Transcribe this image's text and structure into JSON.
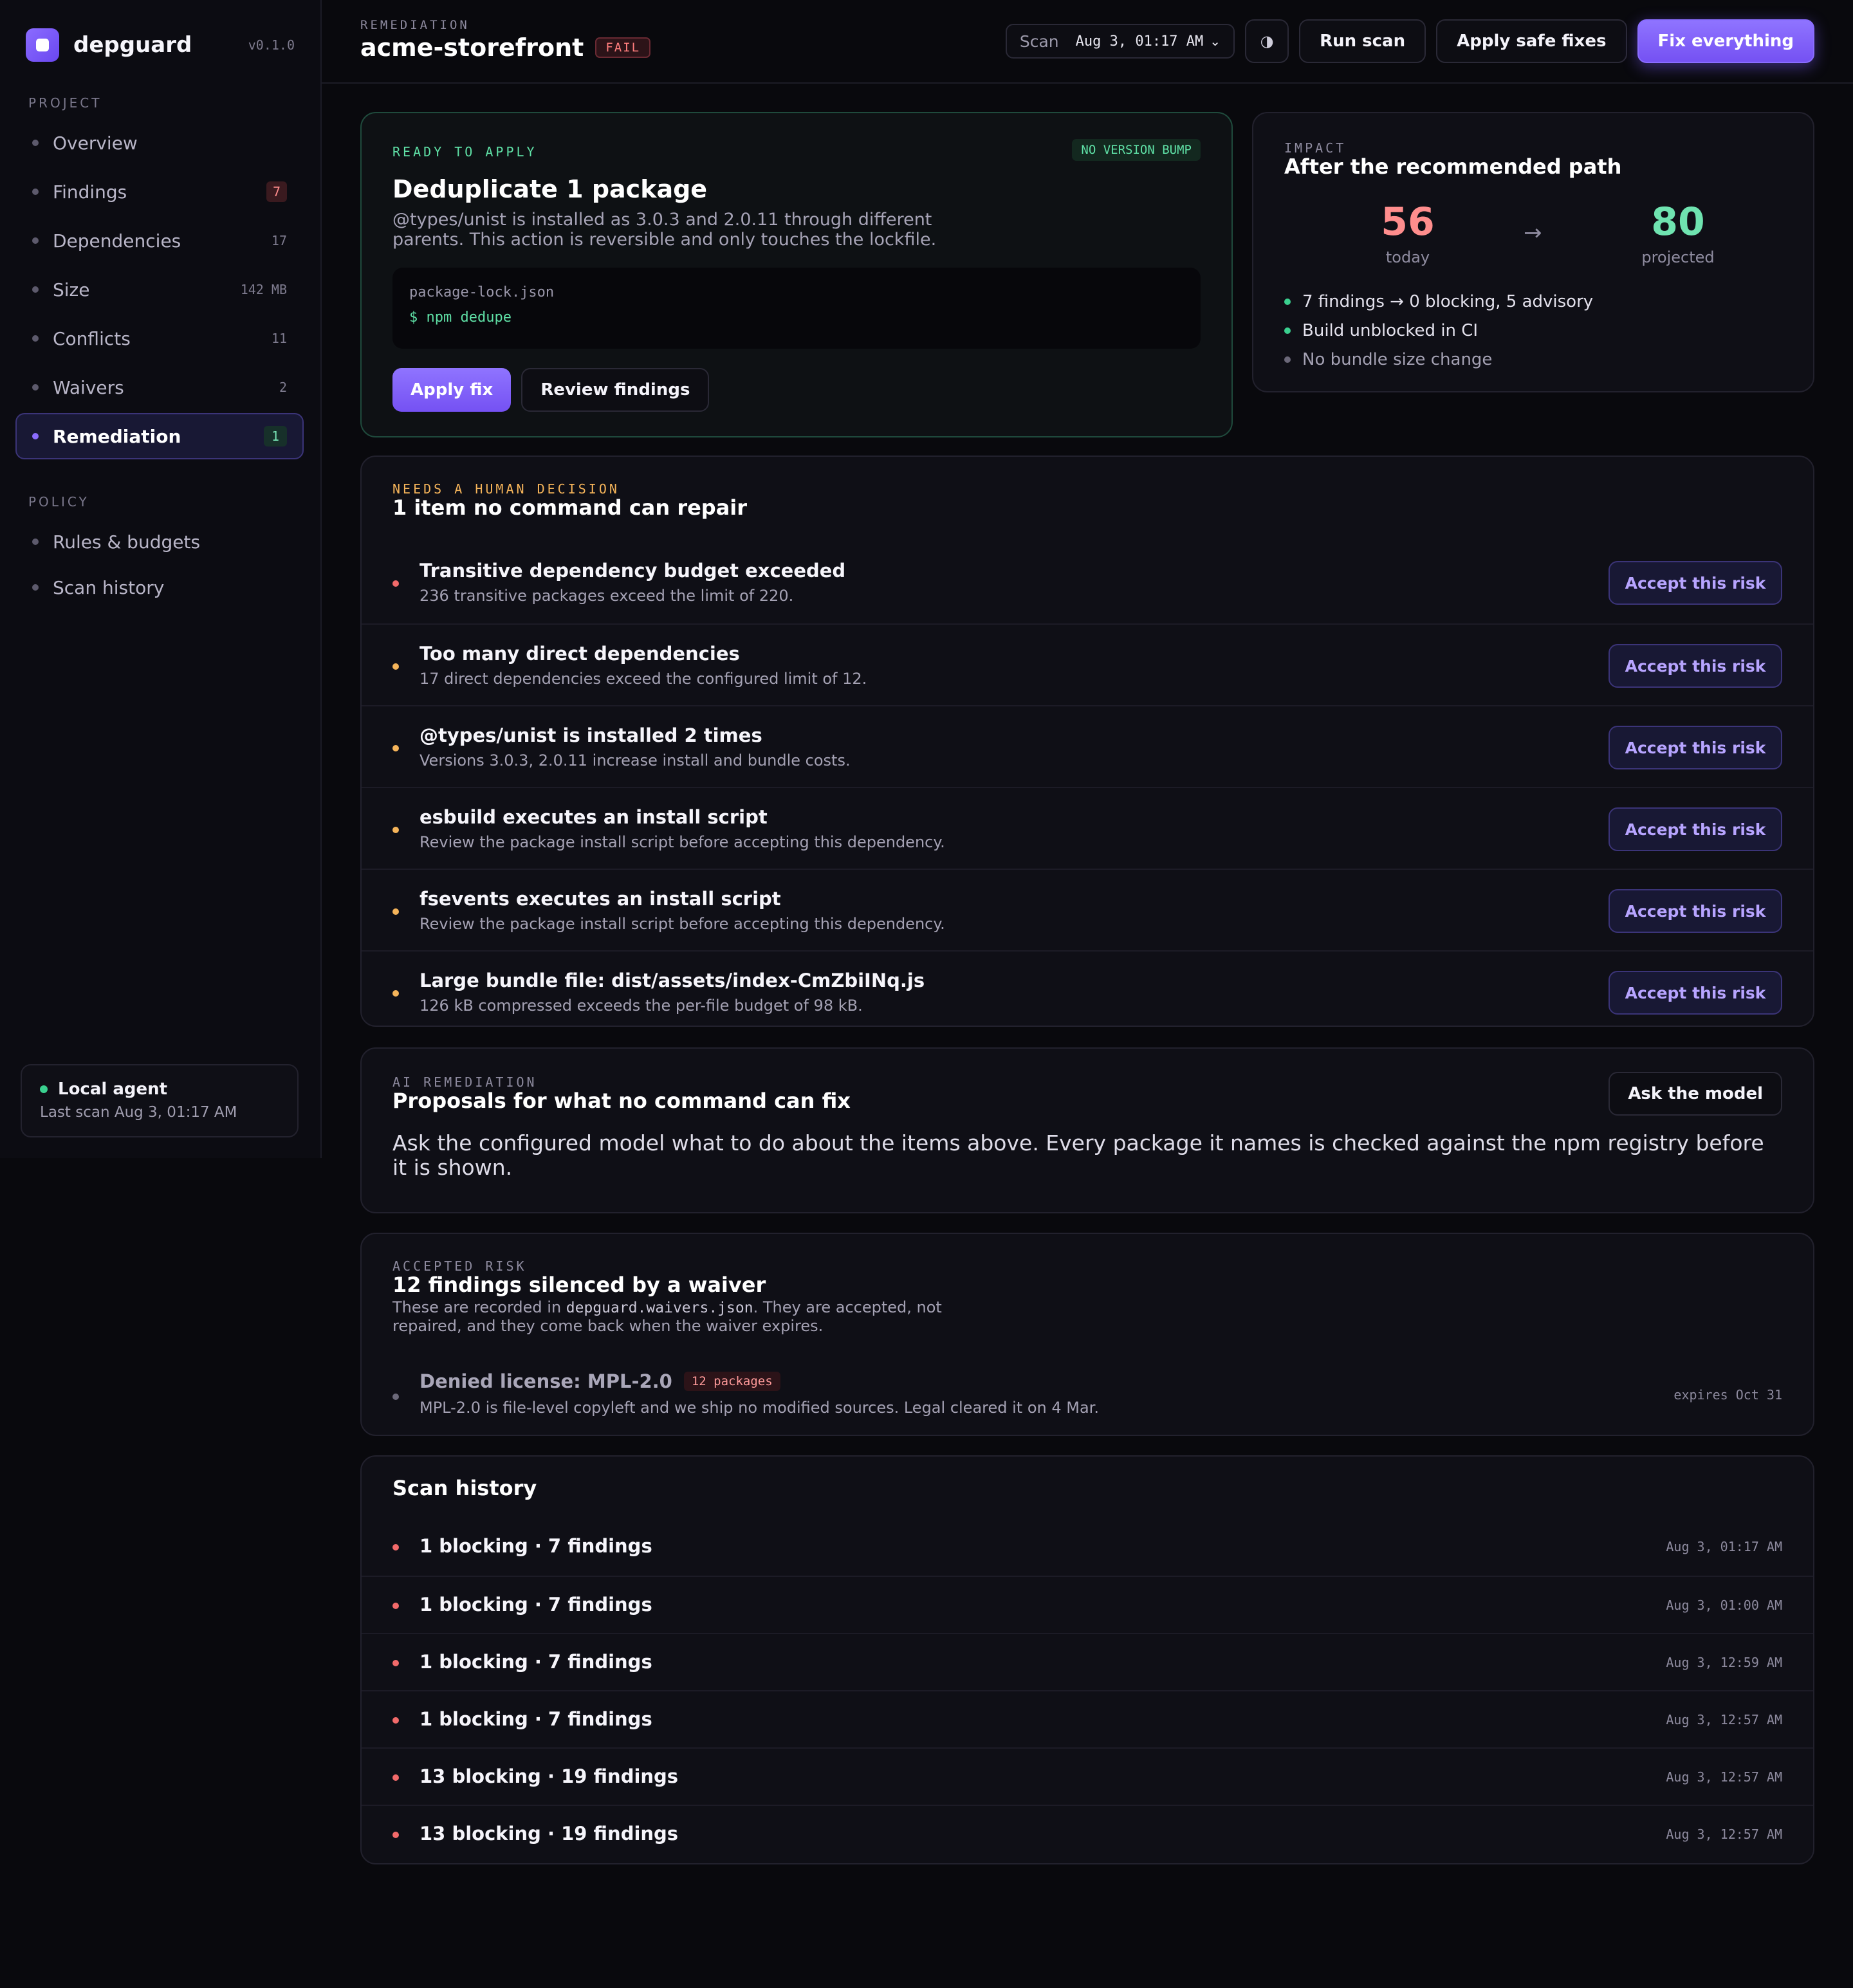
{
  "sidebar": {
    "brand": "depguard",
    "version": "v0.1.0",
    "project_label": "PROJECT",
    "nav": [
      {
        "label": "Overview",
        "count": ""
      },
      {
        "label": "Findings",
        "count": "7"
      },
      {
        "label": "Dependencies",
        "count": "17"
      },
      {
        "label": "Size",
        "count": "142 MB"
      },
      {
        "label": "Conflicts",
        "count": "11"
      },
      {
        "label": "Waivers",
        "count": "2"
      },
      {
        "label": "Remediation",
        "count": "1"
      }
    ],
    "policy_label": "POLICY",
    "policy_nav": [
      {
        "label": "Rules & budgets"
      },
      {
        "label": "Scan history"
      }
    ],
    "agent": {
      "title": "Local agent",
      "subtitle": "Last scan Aug 3, 01:17 AM"
    }
  },
  "header": {
    "kicker": "REMEDIATION",
    "title": "acme-storefront",
    "status": "FAIL",
    "scan_label": "Scan",
    "scan_value": "Aug 3, 01:17 AM",
    "theme_icon": "◑",
    "run_scan": "Run scan",
    "apply_safe": "Apply safe fixes",
    "fix_everything": "Fix everything"
  },
  "ready": {
    "kicker": "READY TO APPLY",
    "badge": "NO VERSION BUMP",
    "title": "Deduplicate 1 package",
    "desc": "@types/unist is installed as 3.0.3 and 2.0.11 through different parents. This action is reversible and only touches the lockfile.",
    "file": "package-lock.json",
    "command": "$ npm dedupe",
    "apply": "Apply fix",
    "review": "Review findings"
  },
  "impact": {
    "kicker": "IMPACT",
    "title": "After the recommended path",
    "today_value": "56",
    "today_label": "today",
    "arrow": "→",
    "projected_value": "80",
    "projected_label": "projected",
    "items": [
      "7 findings → 0 blocking, 5 advisory",
      "Build unblocked in CI",
      "No bundle size change"
    ]
  },
  "human": {
    "kicker": "NEEDS A HUMAN DECISION",
    "title": "1 item no command can repair",
    "accept_label": "Accept this risk",
    "items": [
      {
        "title": "Transitive dependency budget exceeded",
        "subtitle": "236 transitive packages exceed the limit of 220.",
        "severity": "#f26a6a"
      },
      {
        "title": "Too many direct dependencies",
        "subtitle": "17 direct dependencies exceed the configured limit of 12.",
        "severity": "#f5b45a"
      },
      {
        "title": "@types/unist is installed 2 times",
        "subtitle": "Versions 3.0.3, 2.0.11 increase install and bundle costs.",
        "severity": "#f5b45a"
      },
      {
        "title": "esbuild executes an install script",
        "subtitle": "Review the package install script before accepting this dependency.",
        "severity": "#f5b45a"
      },
      {
        "title": "fsevents executes an install script",
        "subtitle": "Review the package install script before accepting this dependency.",
        "severity": "#f5b45a"
      },
      {
        "title": "Large bundle file: dist/assets/index-CmZbiINq.js",
        "subtitle": "126 kB compressed exceeds the per-file budget of 98 kB.",
        "severity": "#f5b45a"
      }
    ]
  },
  "ai": {
    "kicker": "AI REMEDIATION",
    "title": "Proposals for what no command can fix",
    "ask": "Ask the model",
    "body": "Ask the configured model what to do about the items above. Every package it names is checked against the npm registry before it is shown."
  },
  "waiver": {
    "kicker": "ACCEPTED RISK",
    "title": "12 findings silenced by a waiver",
    "desc_pre": "These are recorded in ",
    "desc_file": "depguard.waivers.json",
    "desc_post": ". They are accepted, not repaired, and they come back when the waiver expires.",
    "item_title": "Denied license: MPL-2.0",
    "item_badge": "12 packages",
    "item_desc": "MPL-2.0 is file-level copyleft and we ship no modified sources. Legal cleared it on 4 Mar.",
    "item_expires": "expires Oct 31"
  },
  "history": {
    "title": "Scan history",
    "rows": [
      {
        "summary": "1 blocking · 7 findings",
        "time": "Aug 3, 01:17 AM"
      },
      {
        "summary": "1 blocking · 7 findings",
        "time": "Aug 3, 01:00 AM"
      },
      {
        "summary": "1 blocking · 7 findings",
        "time": "Aug 3, 12:59 AM"
      },
      {
        "summary": "1 blocking · 7 findings",
        "time": "Aug 3, 12:57 AM"
      },
      {
        "summary": "13 blocking · 19 findings",
        "time": "Aug 3, 12:57 AM"
      },
      {
        "summary": "13 blocking · 19 findings",
        "time": "Aug 3, 12:57 AM"
      }
    ]
  },
  "colors": {
    "accent": "#7b5af5",
    "success": "#3ad08f",
    "danger": "#f26a6a",
    "warning": "#f5b45a"
  }
}
